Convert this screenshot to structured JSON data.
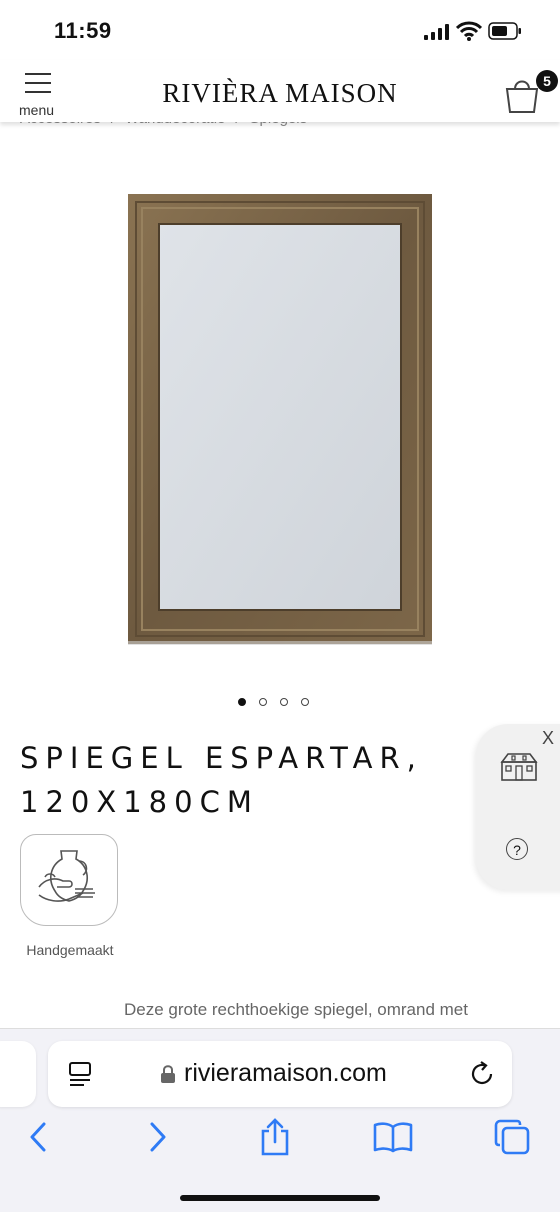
{
  "status_bar": {
    "time": "11:59"
  },
  "header": {
    "menu_label": "menu",
    "logo": "RIVIÈRA MAISON",
    "cart_count": "5"
  },
  "breadcrumb": [
    "Accessoires",
    "Wanddecoratie",
    "Spiegels"
  ],
  "product": {
    "title_line1": "SPIEGEL ESPARTAR,",
    "title_line2": "120X180CM",
    "carousel_total": 4,
    "carousel_active": 1,
    "badge_label": "Handgemaakt",
    "description_snippet": "Deze grote rechthoekige spiegel, omrand met"
  },
  "side_widget": {
    "close_label": "X",
    "help_label": "?"
  },
  "browser": {
    "url": "rivieramaison.com"
  },
  "colors": {
    "accent": "#2f7bf5",
    "frame_wood": "#7a6448",
    "text": "#111111"
  }
}
